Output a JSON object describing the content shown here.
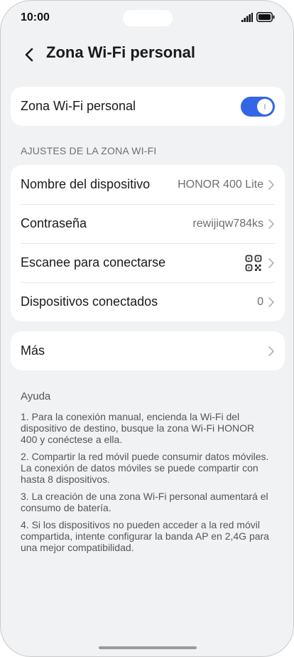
{
  "status_bar": {
    "time": "10:00",
    "signal_icon": "signal-icon",
    "battery_icon": "battery-icon"
  },
  "header": {
    "back_icon": "chevron-left-icon",
    "title": "Zona Wi-Fi personal"
  },
  "hotspot_card": {
    "label": "Zona Wi-Fi personal",
    "toggle_on": true,
    "accent_color": "#3366e6"
  },
  "settings_section": {
    "label": "AJUSTES DE LA ZONA WI-FI",
    "rows": [
      {
        "label": "Nombre del dispositivo",
        "value": "HONOR 400 Lite"
      },
      {
        "label": "Contraseña",
        "value": "rewijiqw784ks"
      },
      {
        "label": "Escanee para conectarse",
        "icon": "qr-code-icon"
      },
      {
        "label": "Dispositivos conectados",
        "value": "0"
      }
    ]
  },
  "more_card": {
    "label": "Más"
  },
  "help": {
    "title": "Ayuda",
    "items": [
      "1. Para la conexión manual, encienda la Wi-Fi del dispositivo de destino, busque la zona Wi-Fi HONOR 400 y conéctese a ella.",
      "2. Compartir la red móvil puede consumir datos móviles. La conexión de datos móviles se puede compartir con hasta 8 dispositivos.",
      "3. La creación de una zona Wi-Fi personal aumentará el consumo de batería.",
      "4. Si los dispositivos no pueden acceder a la red móvil compartida, intente configurar la banda AP en 2,4G para una mejor compatibilidad."
    ]
  }
}
